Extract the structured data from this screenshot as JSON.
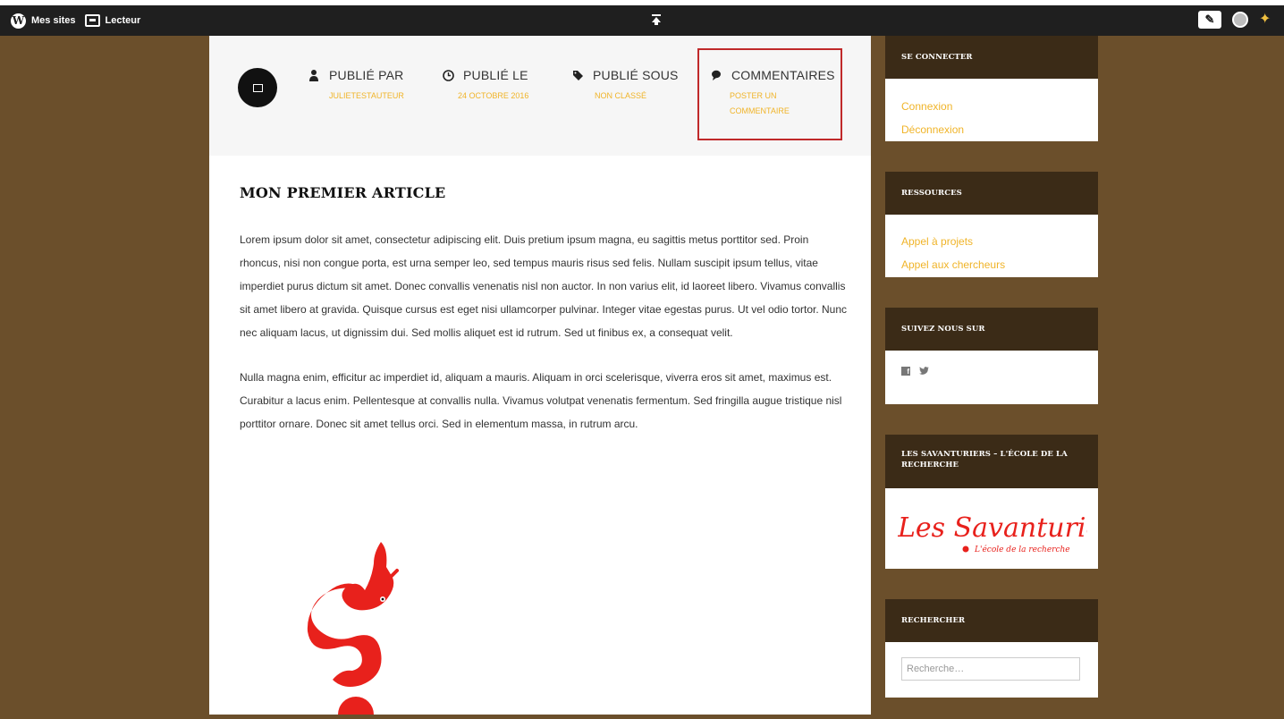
{
  "adminbar": {
    "my_sites": "Mes sites",
    "reader": "Lecteur",
    "center_icon": "pin-up-icon",
    "write_icon": "edit-icon",
    "avatar_icon": "avatar-icon",
    "notifications_icon": "notifications-icon"
  },
  "meta": {
    "author_label": "PUBLIÉ PAR",
    "author_value": "JULIETESTAUTEUR",
    "date_label": "PUBLIÉ LE",
    "date_value": "24 OCTOBRE 2016",
    "category_label": "PUBLIÉ SOUS",
    "category_value": "NON CLASSÉ",
    "comments_label": "COMMENTAIRES",
    "comments_value_line1": "POSTER UN",
    "comments_value_line2": "COMMENTAIRE"
  },
  "article": {
    "title": "MON PREMIER ARTICLE",
    "paragraph_1": "Lorem ipsum dolor sit amet, consectetur adipiscing elit. Duis pretium ipsum magna, eu sagittis metus porttitor sed. Proin rhoncus, nisi non congue porta, est urna semper leo, sed tempus mauris risus sed felis. Nullam suscipit ipsum tellus, vitae imperdiet purus dictum sit amet. Donec convallis venenatis nisl non auctor. In non varius elit, id laoreet libero. Vivamus convallis sit amet libero at gravida. Quisque cursus est eget nisi ullamcorper pulvinar. Integer vitae egestas purus. Ut vel odio tortor. Nunc nec aliquam lacus, ut dignissim dui. Sed mollis aliquet est id rutrum. Sed ut finibus ex, a consequat velit.",
    "paragraph_2": "Nulla magna enim, efficitur ac imperdiet id, aliquam a mauris. Aliquam in orci scelerisque, viverra eros sit amet, maximus est. Curabitur a lacus enim. Pellentesque at convallis nulla. Vivamus volutpat venenatis fermentum. Sed fringilla augue tristique nisl porttitor ornare. Donec sit amet tellus orci. Sed in elementum massa, in rutrum arcu."
  },
  "sidebar": {
    "login": {
      "title": "SE CONNECTER",
      "links": [
        "Connexion",
        "Déconnexion"
      ]
    },
    "resources": {
      "title": "RESSOURCES",
      "links": [
        "Appel à projets",
        "Appel aux chercheurs"
      ]
    },
    "follow": {
      "title": "SUIVEZ NOUS SUR",
      "icons": [
        "facebook-icon",
        "twitter-icon"
      ]
    },
    "savanturiers": {
      "title": "LES SAVANTURIERS – L'ÉCOLE DE LA RECHERCHE",
      "logo_text": "Les Savanturiers",
      "logo_tagline": "L'école de la recherche"
    },
    "search": {
      "title": "RECHERCHER",
      "placeholder": "Recherche…"
    }
  },
  "colors": {
    "background": "#6b4f2b",
    "admin_bar": "#1f1f1f",
    "accent": "#f0b429",
    "widget_header": "#3b2b17",
    "highlight_border": "#c0292a",
    "logo_red": "#e8211c"
  }
}
